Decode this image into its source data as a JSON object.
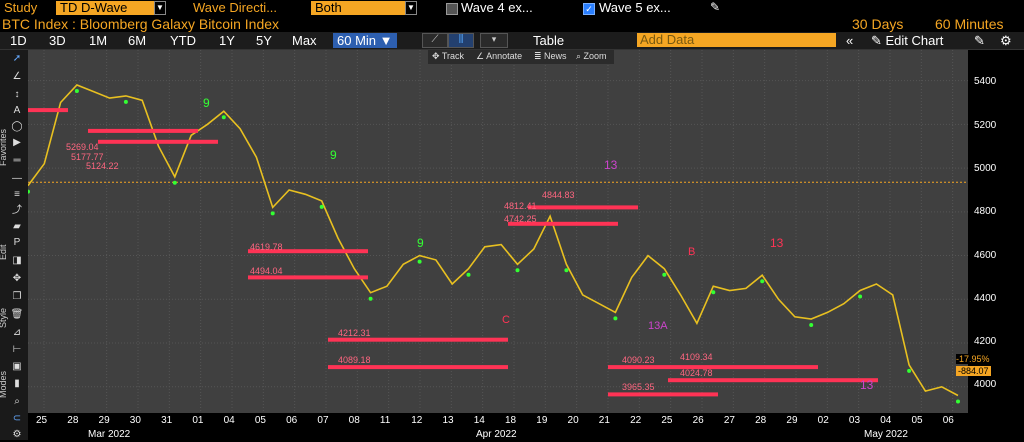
{
  "toolbar": {
    "study_label": "Study",
    "study_value": "TD D-Wave",
    "wave_direction_label": "Wave Directi...",
    "wave_direction_value": "Both",
    "wave4_label": "Wave 4 ex...",
    "wave5_label": "Wave 5 ex..."
  },
  "header": {
    "title": "BTC Index : Bloomberg Galaxy Bitcoin Index",
    "period": "30 Days",
    "interval": "60 Minutes"
  },
  "ranges": [
    "1D",
    "3D",
    "1M",
    "6M",
    "YTD",
    "1Y",
    "5Y",
    "Max"
  ],
  "interval_select": "60 Min",
  "table_label": "Table",
  "add_data_placeholder": "Add Data",
  "edit_chart_label": "Edit Chart",
  "mini_toolbar": [
    "Track",
    "Annotate",
    "News",
    "Zoom"
  ],
  "left_tabs": [
    "Favorites",
    "Edit",
    "Style",
    "Modes"
  ],
  "yaxis": [
    "5400",
    "5200",
    "5000",
    "4800",
    "4600",
    "4400",
    "4200",
    "4000"
  ],
  "xaxis_days": [
    "25",
    "28",
    "29",
    "30",
    "31",
    "01",
    "04",
    "05",
    "06",
    "07",
    "08",
    "11",
    "12",
    "13",
    "14",
    "18",
    "19",
    "20",
    "21",
    "22",
    "25",
    "26",
    "27",
    "28",
    "29",
    "02",
    "03",
    "04",
    "05",
    "06"
  ],
  "xaxis_months": [
    "Mar 2022",
    "Apr 2022",
    "May 2022"
  ],
  "right_labels": {
    "pct": "-17.95%",
    "value": "-884.07"
  },
  "price_labels": [
    "5269.04",
    "5177.77",
    "5124.22",
    "4913.4",
    "4844.83",
    "4812.41",
    "4742.25",
    "4619.78",
    "4494.04",
    "4212.31",
    "4089.18",
    "4090.23",
    "4109.34",
    "4024.78",
    "3965.35"
  ],
  "colors": {
    "orange": "#f5a623",
    "bg": "#404040",
    "red": "#ff3355",
    "green": "#33ff33",
    "magenta": "#cc44cc"
  },
  "chart_data": {
    "type": "line",
    "title": "BTC Index : Bloomberg Galaxy Bitcoin Index",
    "ylim": [
      3880,
      5540
    ],
    "series": [
      {
        "values": [
          4920,
          5020,
          5300,
          5380,
          5350,
          5320,
          5330,
          5310,
          5100,
          4960,
          5150,
          5200,
          5260,
          5180,
          5050,
          4820,
          4900,
          4880,
          4850,
          4680,
          4540,
          4430,
          4460,
          4560,
          4600,
          4580,
          4470,
          4540,
          4640,
          4650,
          4560,
          4630,
          4780,
          4560,
          4420,
          4380,
          4340,
          4500,
          4600,
          4540,
          4420,
          4290,
          4460,
          4440,
          4450,
          4510,
          4400,
          4320,
          4310,
          4340,
          4380,
          4440,
          4470,
          4420,
          4100,
          3980,
          4000,
          3960
        ]
      }
    ]
  }
}
